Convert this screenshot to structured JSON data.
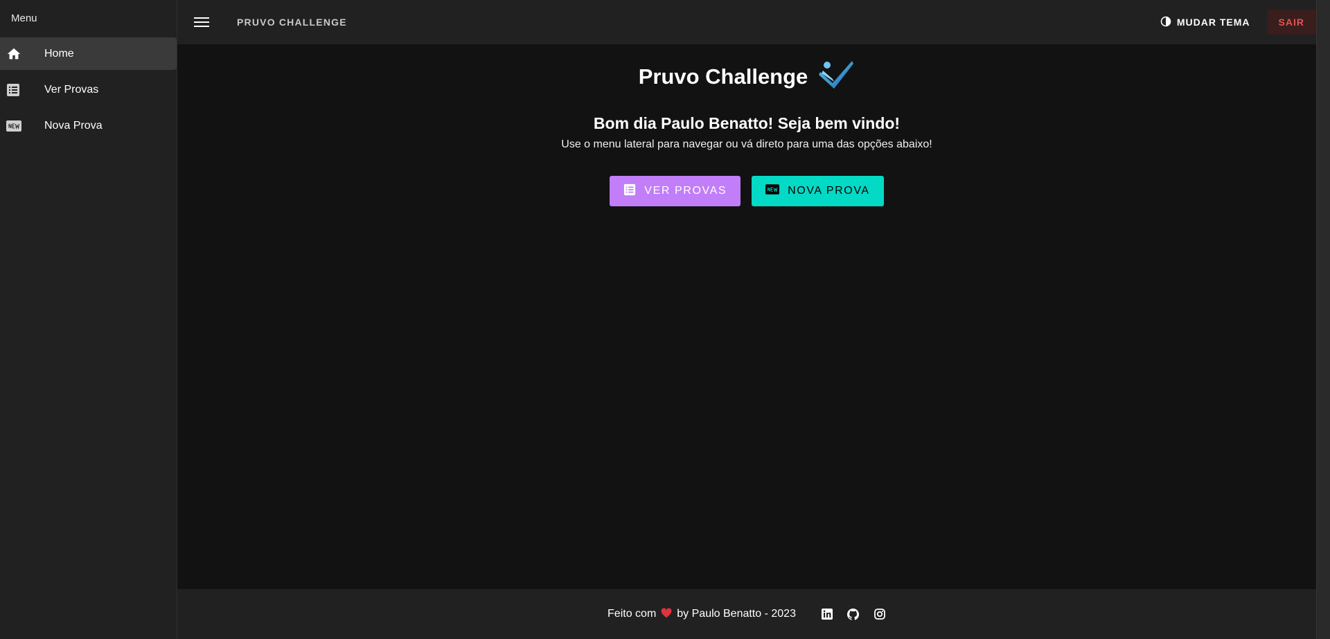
{
  "sidebar": {
    "title": "Menu",
    "items": [
      {
        "label": "Home",
        "icon": "home-icon"
      },
      {
        "label": "Ver Provas",
        "icon": "list-icon"
      },
      {
        "label": "Nova Prova",
        "icon": "new-badge-icon"
      }
    ]
  },
  "header": {
    "app_title": "PRUVO CHALLENGE",
    "theme_label": "MUDAR TEMA",
    "logout_label": "SAIR"
  },
  "main": {
    "title": "Pruvo Challenge",
    "greeting": "Bom dia Paulo Benatto! Seja bem vindo!",
    "subtitle": "Use o menu lateral para navegar ou vá direto para uma das opções abaixo!",
    "actions": [
      {
        "label": "VER PROVAS",
        "icon": "list-icon",
        "color": "#c17ef8"
      },
      {
        "label": "NOVA PROVA",
        "icon": "new-badge-icon",
        "color": "#03dac5"
      }
    ]
  },
  "footer": {
    "text_before": "Feito com",
    "text_after": "by Paulo Benatto - 2023",
    "social": [
      "linkedin-icon",
      "github-icon",
      "instagram-icon"
    ]
  },
  "colors": {
    "background": "#121212",
    "surface": "#212121",
    "accent_purple": "#c17ef8",
    "accent_teal": "#03dac5",
    "danger": "#e05555"
  }
}
